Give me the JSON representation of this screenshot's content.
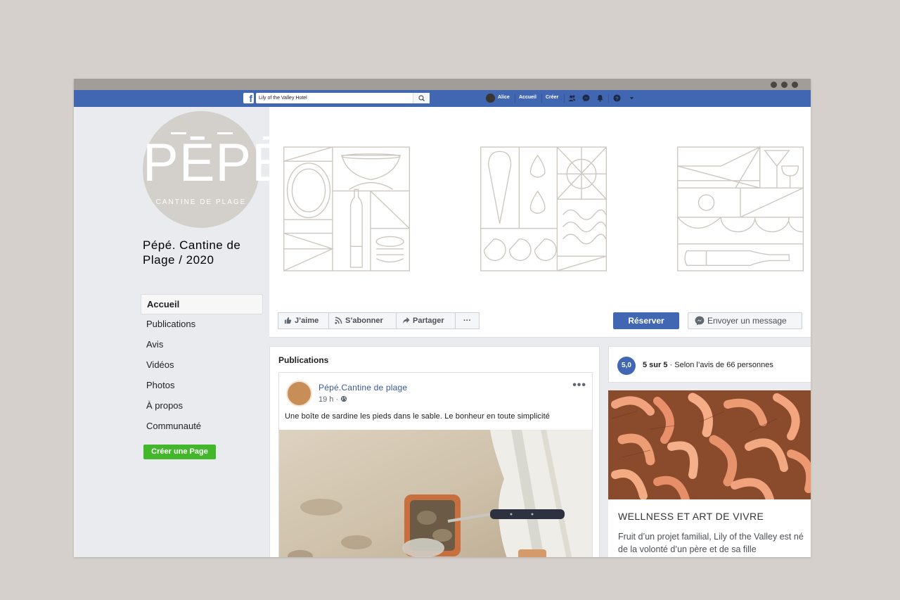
{
  "topbar": {
    "search_value": "Lily of the Valley Hotel",
    "user_name": "Alice",
    "home_label": "Accueil",
    "create_label": "Créer"
  },
  "profile": {
    "logo_text": "PĒPĒ",
    "logo_subtitle": "CANTINE DE PLAGE",
    "page_name": "Pépé. Cantine de Plage / 2020"
  },
  "sidebar": {
    "items": [
      {
        "label": "Accueil",
        "active": true
      },
      {
        "label": "Publications"
      },
      {
        "label": "Avis"
      },
      {
        "label": "Vidéos"
      },
      {
        "label": "Photos"
      },
      {
        "label": "À propos"
      },
      {
        "label": "Communauté"
      }
    ],
    "create_page_label": "Créer une Page"
  },
  "actions": {
    "like_label": "J’aime",
    "follow_label": "S’abonner",
    "share_label": "Partager",
    "more_label": "···",
    "reserve_label": "Réserver",
    "message_label": "Envoyer un message"
  },
  "publications": {
    "title": "Publications",
    "post": {
      "author": "Pépé.Cantine de plage",
      "time": "19 h ·",
      "text": "Une boîte de sardine les pieds dans le sable. Le bonheur en toute simplicité"
    }
  },
  "rating": {
    "score": "5,0",
    "bold": "5 sur 5",
    "rest": " · Selon l’avis de 66 personnes"
  },
  "about": {
    "title": "WELLNESS ET ART DE VIVRE",
    "text": "Fruit d’un projet familial, Lily of the Valley est né de la volonté d’un père et de sa fille"
  },
  "colors": {
    "facebook_blue": "#4267b2",
    "green": "#42b72a",
    "line_art": "#cdc7c1"
  }
}
